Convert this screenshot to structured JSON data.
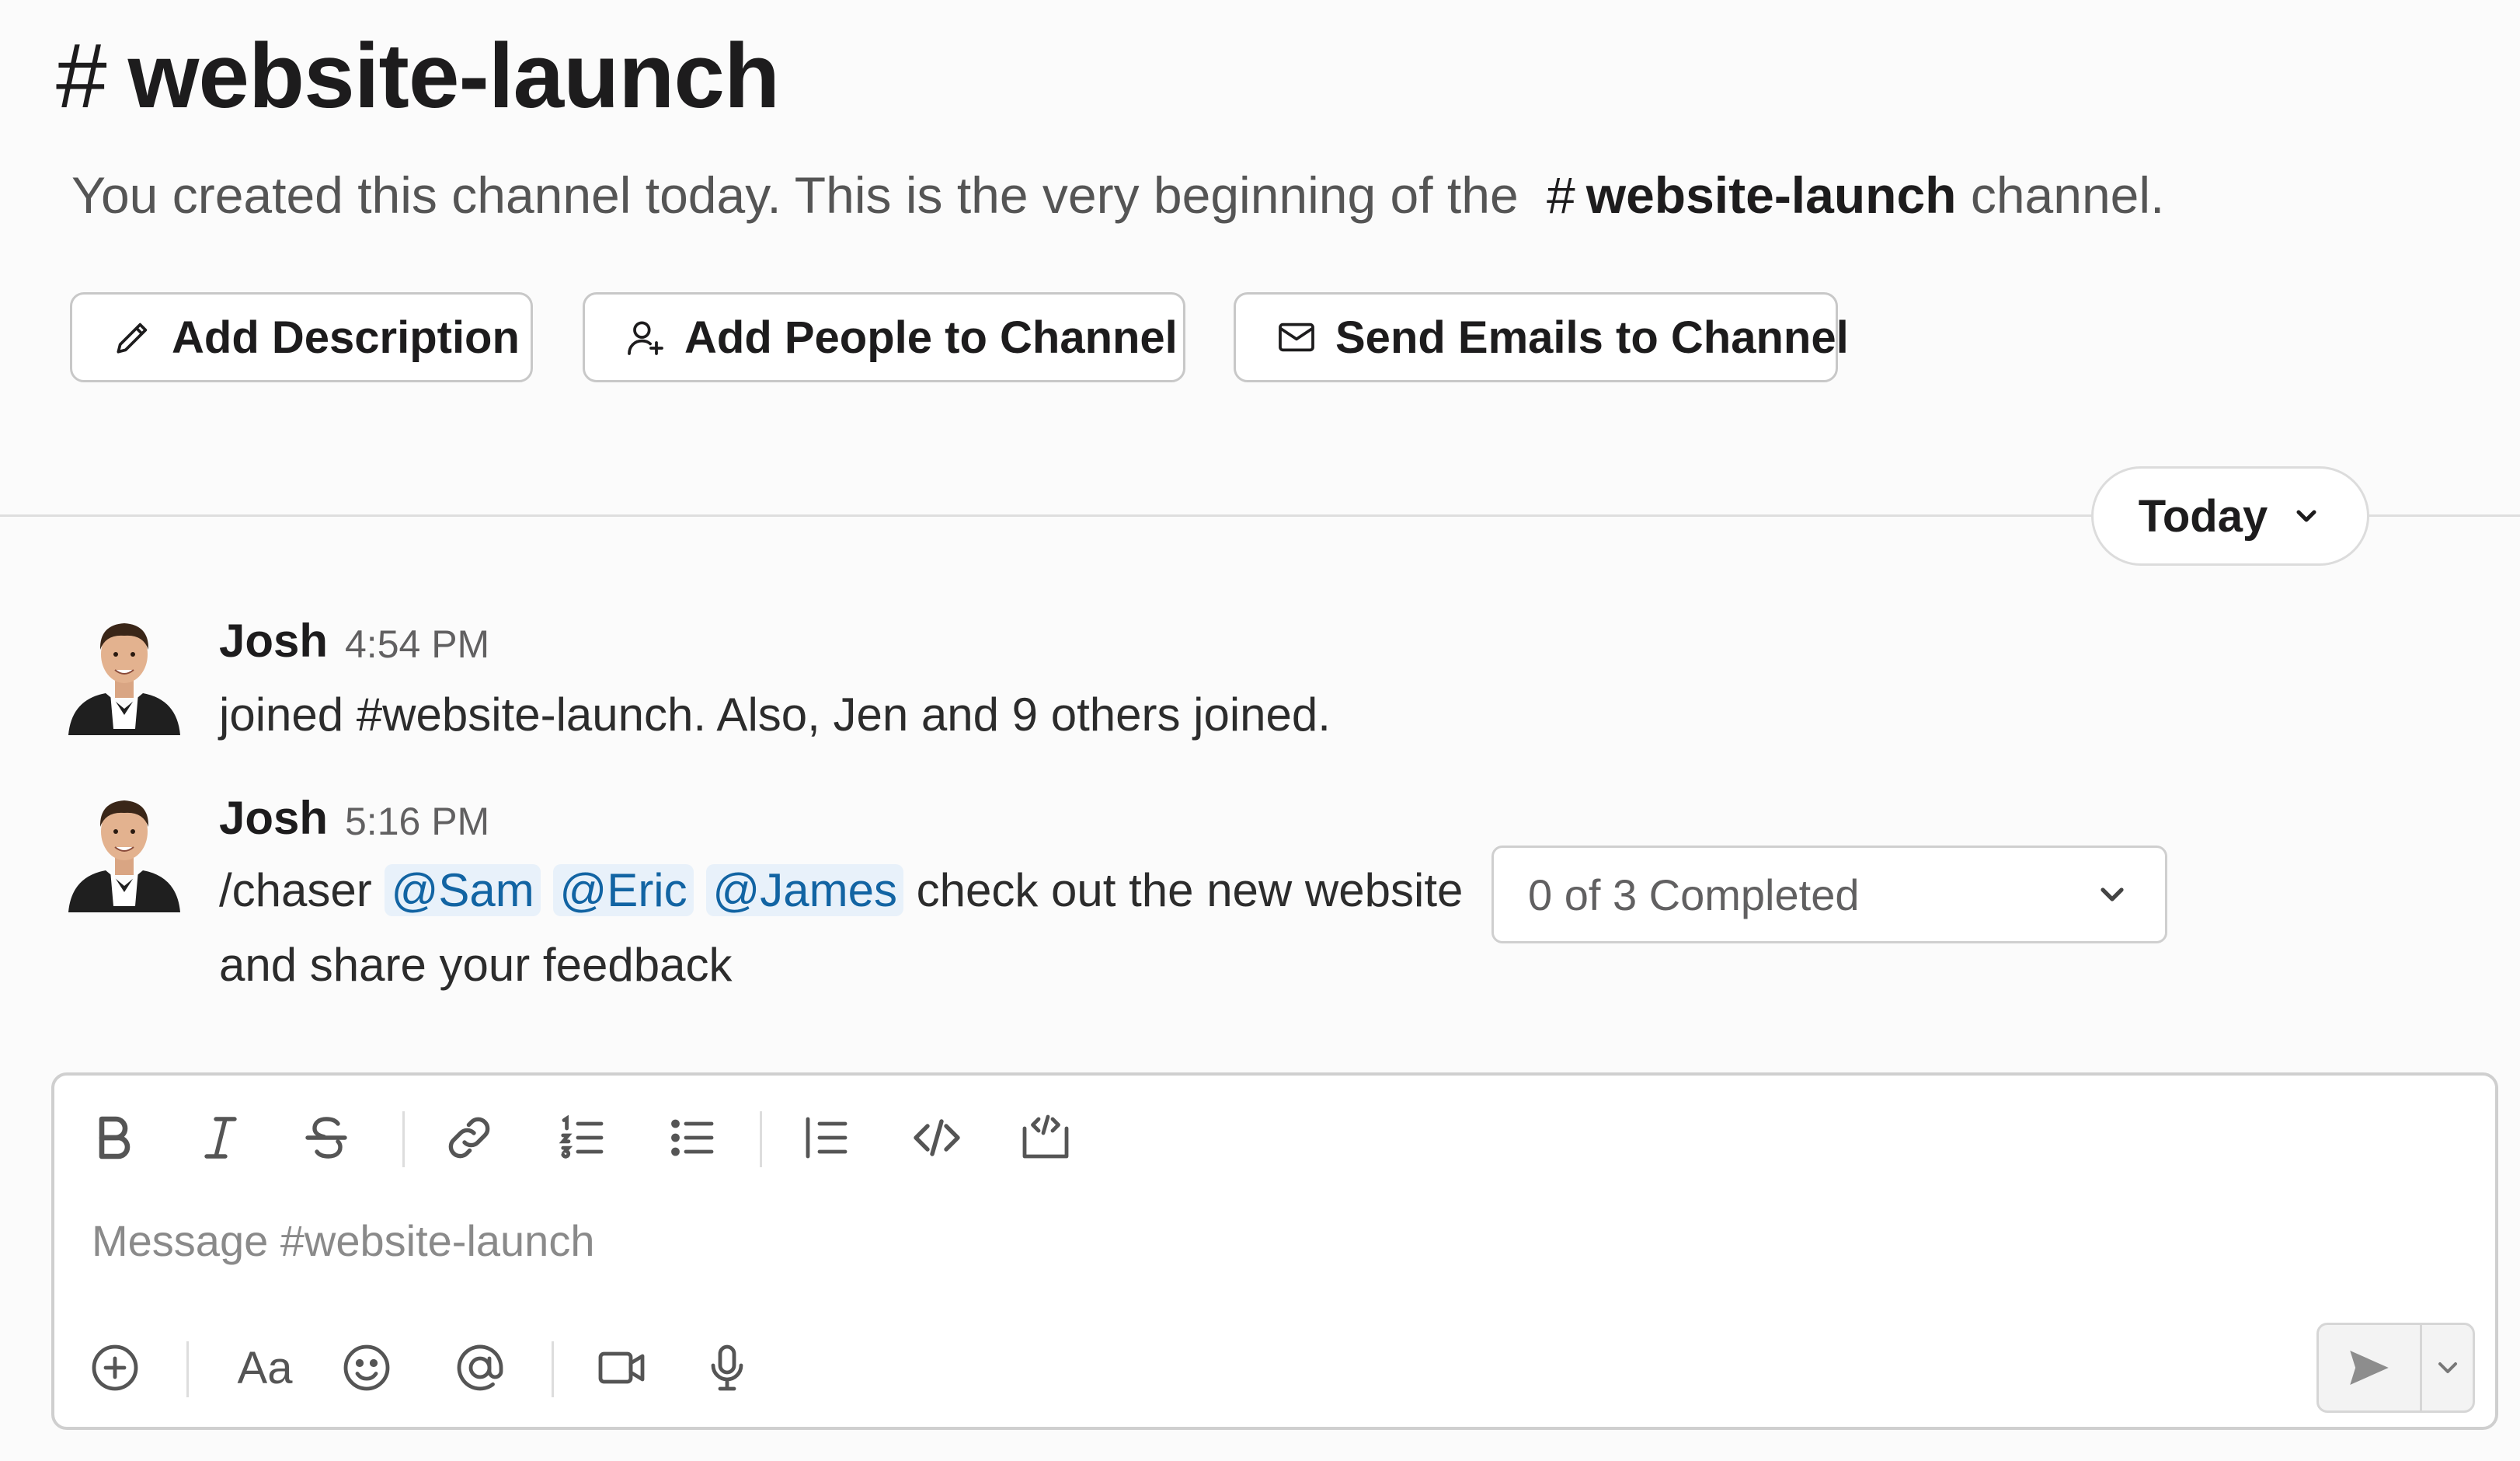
{
  "channel": {
    "hash": "#",
    "name": "website-launch"
  },
  "intro": {
    "text_before": "You created this channel today. This is the very beginning of the",
    "channel_hash": "#",
    "channel_name": "website-launch",
    "text_after": "channel."
  },
  "actions": {
    "add_description": "Add Description",
    "add_people": "Add People to Channel",
    "send_emails": "Send Emails to Channel"
  },
  "date_divider": {
    "label": "Today"
  },
  "messages": [
    {
      "author": "Josh",
      "time": "4:54 PM",
      "text": "joined #website-launch. Also, Jen and 9 others joined."
    },
    {
      "author": "Josh",
      "time": "5:16 PM",
      "command": "/chaser",
      "mentions": [
        "@Sam",
        "@Eric",
        "@James"
      ],
      "text_line1": "check out the new website",
      "text_line2": "and share your feedback",
      "progress_label": "0 of 3 Completed"
    }
  ],
  "composer": {
    "placeholder": "Message #website-launch",
    "format_toolbar": [
      "bold-icon",
      "italic-icon",
      "strikethrough-icon",
      "link-icon",
      "ordered-list-icon",
      "bulleted-list-icon",
      "blockquote-icon",
      "code-icon",
      "code-block-icon"
    ],
    "bottom_toolbar": [
      "plus-icon",
      "formatting-icon",
      "emoji-icon",
      "mention-icon",
      "video-icon",
      "microphone-icon"
    ],
    "formatting_label": "Aa"
  },
  "colors": {
    "mention_text": "#1264a3",
    "mention_bg": "#e8f1fa",
    "border": "#cfcfcf"
  }
}
